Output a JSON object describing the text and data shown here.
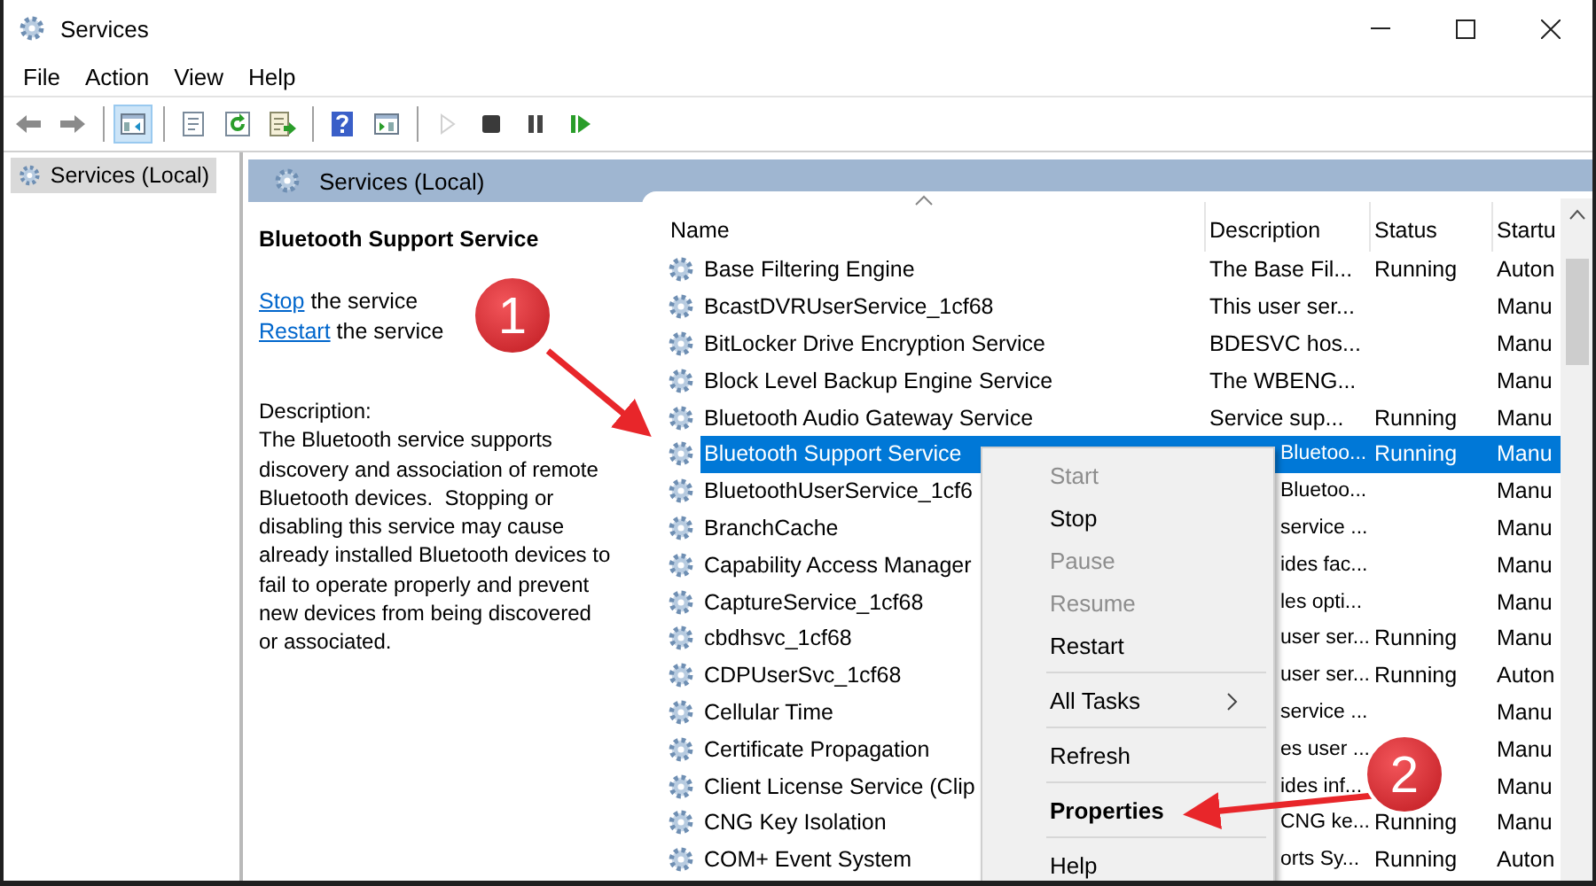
{
  "window": {
    "title": "Services"
  },
  "menu": [
    "File",
    "Action",
    "View",
    "Help"
  ],
  "toolbar": [
    {
      "kind": "back",
      "pressed": false,
      "disabled": false
    },
    {
      "kind": "forward",
      "pressed": false,
      "disabled": false
    },
    {
      "kind": "separator"
    },
    {
      "kind": "tree",
      "pressed": true,
      "disabled": false
    },
    {
      "kind": "separator"
    },
    {
      "kind": "properties",
      "pressed": false,
      "disabled": false
    },
    {
      "kind": "refresh",
      "pressed": false,
      "disabled": false
    },
    {
      "kind": "export",
      "pressed": false,
      "disabled": false
    },
    {
      "kind": "separator"
    },
    {
      "kind": "help",
      "pressed": false,
      "disabled": false
    },
    {
      "kind": "console",
      "pressed": false,
      "disabled": false
    },
    {
      "kind": "separator"
    },
    {
      "kind": "play",
      "pressed": false,
      "disabled": true
    },
    {
      "kind": "stop",
      "pressed": false,
      "disabled": false
    },
    {
      "kind": "pause",
      "pressed": false,
      "disabled": false
    },
    {
      "kind": "resume",
      "pressed": false,
      "disabled": false
    }
  ],
  "tree": {
    "items": [
      {
        "label": "Services (Local)",
        "selected": true
      }
    ]
  },
  "pane": {
    "title": "Services (Local)"
  },
  "details": {
    "title": "Bluetooth Support Service",
    "actions": [
      {
        "link": "Stop",
        "text": " the service"
      },
      {
        "link": "Restart",
        "text": " the service"
      }
    ],
    "description_label": "Description:",
    "description": "The Bluetooth service supports\ndiscovery and association of remote\nBluetooth devices.  Stopping or\ndisabling this service may cause\nalready installed Bluetooth devices to\nfail to operate properly and prevent\nnew devices from being discovered\nor associated."
  },
  "table": {
    "columns": [
      {
        "label": "Name",
        "sorted": true
      },
      {
        "label": "Description",
        "sorted": false
      },
      {
        "label": "Status",
        "sorted": false
      },
      {
        "label": "Startu",
        "sorted": false
      }
    ],
    "rows": [
      {
        "name": "Base Filtering Engine",
        "description": "The Base Fil...",
        "status": "Running",
        "startup": "Auton",
        "selected": false
      },
      {
        "name": "BcastDVRUserService_1cf68",
        "description": "This user ser...",
        "startup": "Manu",
        "selected": false
      },
      {
        "name": "BitLocker Drive Encryption Service",
        "description": "BDESVC hos...",
        "startup": "Manu",
        "selected": false
      },
      {
        "name": "Block Level Backup Engine Service",
        "description": "The WBENG...",
        "startup": "Manu",
        "selected": false
      },
      {
        "name": "Bluetooth Audio Gateway Service",
        "description": "Service sup...",
        "status": "Running",
        "startup": "Manu",
        "selected": false
      },
      {
        "name": "Bluetooth Support Service",
        "description": "Bluetoo...",
        "status": "Running",
        "startup": "Manu",
        "selected": true
      },
      {
        "name": "BluetoothUserService_1cf6",
        "description": "Bluetoo...",
        "startup": "Manu",
        "selected": false
      },
      {
        "name": "BranchCache",
        "description": "service ...",
        "startup": "Manu",
        "selected": false
      },
      {
        "name": "Capability Access Manager",
        "description": "ides fac...",
        "startup": "Manu",
        "selected": false
      },
      {
        "name": "CaptureService_1cf68",
        "description": "les opti...",
        "startup": "Manu",
        "selected": false
      },
      {
        "name": "cbdhsvc_1cf68",
        "description": "user ser...",
        "status": "Running",
        "startup": "Manu",
        "selected": false
      },
      {
        "name": "CDPUserSvc_1cf68",
        "description": "user ser...",
        "status": "Running",
        "startup": "Auton",
        "selected": false
      },
      {
        "name": "Cellular Time",
        "description": "service ...",
        "startup": "Manu",
        "selected": false
      },
      {
        "name": "Certificate Propagation",
        "description": "es user ...",
        "startup": "Manu",
        "selected": false
      },
      {
        "name": "Client License Service (Clip",
        "description": "ides inf...",
        "startup": "Manu",
        "selected": false
      },
      {
        "name": "CNG Key Isolation",
        "description": "CNG ke...",
        "status": "Running",
        "startup": "Manu",
        "selected": false
      },
      {
        "name": "COM+ Event System",
        "description": "orts Sy...",
        "status": "Running",
        "startup": "Auton",
        "selected": false
      }
    ]
  },
  "context_menu": {
    "items": [
      {
        "kind": "item",
        "label": "Start",
        "disabled": true,
        "default": false,
        "submenu": false
      },
      {
        "kind": "item",
        "label": "Stop",
        "disabled": false,
        "default": false,
        "submenu": false
      },
      {
        "kind": "item",
        "label": "Pause",
        "disabled": true,
        "default": false,
        "submenu": false
      },
      {
        "kind": "item",
        "label": "Resume",
        "disabled": true,
        "default": false,
        "submenu": false
      },
      {
        "kind": "item",
        "label": "Restart",
        "disabled": false,
        "default": false,
        "submenu": false
      },
      {
        "kind": "separator"
      },
      {
        "kind": "item",
        "label": "All Tasks",
        "disabled": false,
        "default": false,
        "submenu": true
      },
      {
        "kind": "separator"
      },
      {
        "kind": "item",
        "label": "Refresh",
        "disabled": false,
        "default": false,
        "submenu": false
      },
      {
        "kind": "separator"
      },
      {
        "kind": "item",
        "label": "Properties",
        "disabled": false,
        "default": true,
        "submenu": false
      },
      {
        "kind": "separator"
      },
      {
        "kind": "item",
        "label": "Help",
        "disabled": false,
        "default": false,
        "submenu": false
      }
    ]
  },
  "annotations": [
    {
      "label": "1"
    },
    {
      "label": "2"
    }
  ]
}
